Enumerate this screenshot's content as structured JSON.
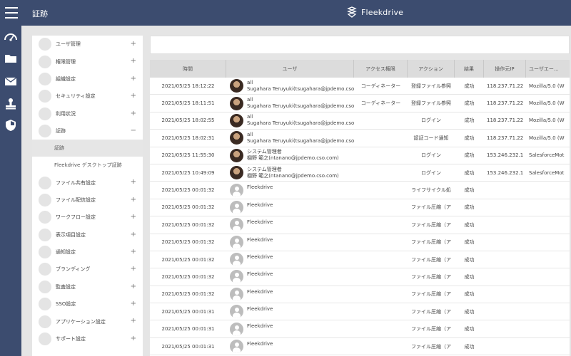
{
  "header": {
    "title": "証跡",
    "brand": "Fleekdrive"
  },
  "rail": {
    "icons": [
      "speedometer-icon",
      "folder-icon",
      "mail-icon",
      "stamp-icon",
      "shield-icon"
    ]
  },
  "menu": {
    "items": [
      {
        "name": "user-management",
        "label": "ユーザ管理",
        "toggle": "+"
      },
      {
        "name": "permission-management",
        "label": "権限管理",
        "toggle": "+"
      },
      {
        "name": "organization-settings",
        "label": "組織設定",
        "toggle": "+"
      },
      {
        "name": "security-settings",
        "label": "セキュリティ設定",
        "toggle": "+"
      },
      {
        "name": "usage-status",
        "label": "利用状況",
        "toggle": "+"
      },
      {
        "name": "audit-trail",
        "label": "証跡",
        "toggle": "−"
      },
      {
        "name": "file-sharing-settings",
        "label": "ファイル共有設定",
        "toggle": "+"
      },
      {
        "name": "file-delivery-settings",
        "label": "ファイル配信設定",
        "toggle": "+"
      },
      {
        "name": "workflow-settings",
        "label": "ワークフロー設定",
        "toggle": "+"
      },
      {
        "name": "display-item-settings",
        "label": "表示項目設定",
        "toggle": "+"
      },
      {
        "name": "notification-settings",
        "label": "通知設定",
        "toggle": "+"
      },
      {
        "name": "branding",
        "label": "ブランディング",
        "toggle": "+"
      },
      {
        "name": "audit-settings",
        "label": "監査設定",
        "toggle": "+"
      },
      {
        "name": "sso-settings",
        "label": "SSO設定",
        "toggle": "+"
      },
      {
        "name": "application-settings",
        "label": "アプリケーション設定",
        "toggle": "+"
      },
      {
        "name": "support-settings",
        "label": "サポート設定",
        "toggle": "+"
      }
    ],
    "sub_items": [
      {
        "label": "証跡",
        "selected": true
      },
      {
        "label": "Fleekdrive デスクトップ証跡",
        "selected": false
      }
    ]
  },
  "table": {
    "columns": [
      "時間",
      "ユーザ",
      "アクセス権限",
      "アクション",
      "結果",
      "操作元IP",
      "ユーザエー..."
    ],
    "rows": [
      {
        "time": "2021/05/25 18:12:22",
        "avatar": "photo",
        "user1": "all",
        "user2": "Sugahara Teruyuki(tsugahara@jpdemo.cso.",
        "access": "コーディネーター",
        "action": "登録ファイル参照",
        "result": "成功",
        "ip": "118.237.71.22",
        "ua": "Mozilla/5.0 (W"
      },
      {
        "time": "2021/05/25 18:11:51",
        "avatar": "photo",
        "user1": "all",
        "user2": "Sugahara Teruyuki(tsugahara@jpdemo.cso.",
        "access": "コーディネーター",
        "action": "登録ファイル参照",
        "result": "成功",
        "ip": "118.237.71.22",
        "ua": "Mozilla/5.0 (W"
      },
      {
        "time": "2021/05/25 18:02:55",
        "avatar": "photo",
        "user1": "all",
        "user2": "Sugahara Teruyuki(tsugahara@jpdemo.cso.",
        "access": "",
        "action": "ログイン",
        "result": "成功",
        "ip": "118.237.71.22",
        "ua": "Mozilla/5.0 (W"
      },
      {
        "time": "2021/05/25 18:02:31",
        "avatar": "photo",
        "user1": "all",
        "user2": "Sugahara Teruyuki(tsugahara@jpdemo.cso.",
        "access": "",
        "action": "認証コード通知",
        "result": "成功",
        "ip": "118.237.71.22",
        "ua": "Mozilla/5.0 (W"
      },
      {
        "time": "2021/05/25 11:55:30",
        "avatar": "photo",
        "user1": "システム管理者",
        "user2": "棚野 範之(ntanano@jpdemo.cso.com)",
        "access": "",
        "action": "ログイン",
        "result": "成功",
        "ip": "153.246.232.1",
        "ua": "SalesforceMot"
      },
      {
        "time": "2021/05/25 10:49:09",
        "avatar": "photo",
        "user1": "システム管理者",
        "user2": "棚野 範之(ntanano@jpdemo.cso.com)",
        "access": "",
        "action": "ログイン",
        "result": "成功",
        "ip": "153.246.232.1",
        "ua": "SalesforceMot"
      },
      {
        "time": "2021/05/25 00:01:32",
        "avatar": "generic",
        "user1": "Fleekdrive",
        "user2": "",
        "access": "",
        "action": "ライフサイクル処",
        "result": "成功",
        "ip": "",
        "ua": ""
      },
      {
        "time": "2021/05/25 00:01:32",
        "avatar": "generic",
        "user1": "Fleekdrive",
        "user2": "",
        "access": "",
        "action": "ファイル圧縮（ア",
        "result": "成功",
        "ip": "",
        "ua": ""
      },
      {
        "time": "2021/05/25 00:01:32",
        "avatar": "generic",
        "user1": "Fleekdrive",
        "user2": "",
        "access": "",
        "action": "ファイル圧縮（ア",
        "result": "成功",
        "ip": "",
        "ua": ""
      },
      {
        "time": "2021/05/25 00:01:32",
        "avatar": "generic",
        "user1": "Fleekdrive",
        "user2": "",
        "access": "",
        "action": "ファイル圧縮（ア",
        "result": "成功",
        "ip": "",
        "ua": ""
      },
      {
        "time": "2021/05/25 00:01:32",
        "avatar": "generic",
        "user1": "Fleekdrive",
        "user2": "",
        "access": "",
        "action": "ファイル圧縮（ア",
        "result": "成功",
        "ip": "",
        "ua": ""
      },
      {
        "time": "2021/05/25 00:01:32",
        "avatar": "generic",
        "user1": "Fleekdrive",
        "user2": "",
        "access": "",
        "action": "ファイル圧縮（ア",
        "result": "成功",
        "ip": "",
        "ua": ""
      },
      {
        "time": "2021/05/25 00:01:32",
        "avatar": "generic",
        "user1": "Fleekdrive",
        "user2": "",
        "access": "",
        "action": "ファイル圧縮（ア",
        "result": "成功",
        "ip": "",
        "ua": ""
      },
      {
        "time": "2021/05/25 00:01:31",
        "avatar": "generic",
        "user1": "Fleekdrive",
        "user2": "",
        "access": "",
        "action": "ファイル圧縮（ア",
        "result": "成功",
        "ip": "",
        "ua": ""
      },
      {
        "time": "2021/05/25 00:01:31",
        "avatar": "generic",
        "user1": "Fleekdrive",
        "user2": "",
        "access": "",
        "action": "ファイル圧縮（ア",
        "result": "成功",
        "ip": "",
        "ua": ""
      },
      {
        "time": "2021/05/25 00:01:31",
        "avatar": "generic",
        "user1": "Fleekdrive",
        "user2": "",
        "access": "",
        "action": "ファイル圧縮（ア",
        "result": "成功",
        "ip": "",
        "ua": ""
      }
    ]
  }
}
